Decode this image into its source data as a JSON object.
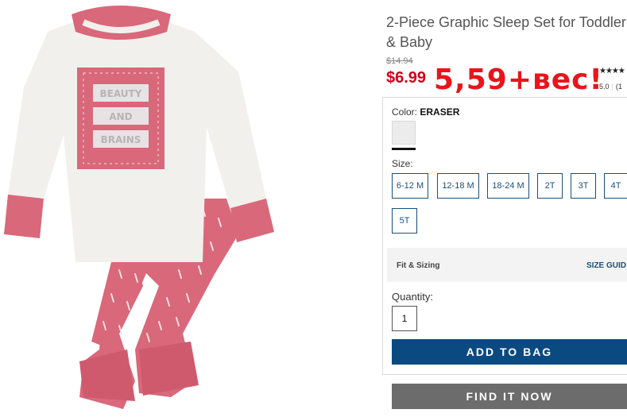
{
  "product": {
    "title": "2-Piece Graphic Sleep Set for Toddler & Baby",
    "old_price": "$14.94",
    "price": "$6.99",
    "handwritten_note": "5,59+вес!",
    "rating_stars": "★★★★",
    "rating_value": "5.0",
    "rating_count": "(1",
    "graphic_text": [
      "BEAUTY",
      "AND",
      "BRAINS"
    ]
  },
  "color": {
    "label": "Color:",
    "value": "ERASER",
    "swatch_color": "#ececec"
  },
  "size": {
    "label": "Size:",
    "options": [
      "6-12 M",
      "12-18 M",
      "18-24 M",
      "2T",
      "3T",
      "4T",
      "5T"
    ]
  },
  "fit": {
    "label": "Fit & Sizing",
    "guide": "SIZE GUID"
  },
  "quantity": {
    "label": "Quantity:",
    "value": "1"
  },
  "buttons": {
    "add_to_bag": "ADD TO BAG",
    "find_it_now": "FIND IT NOW"
  },
  "colors": {
    "brand_blue": "#0b4a80",
    "sale_red": "#d0011b",
    "pajama_pink": "#d9687a",
    "button_gray": "#6c6c6c"
  }
}
